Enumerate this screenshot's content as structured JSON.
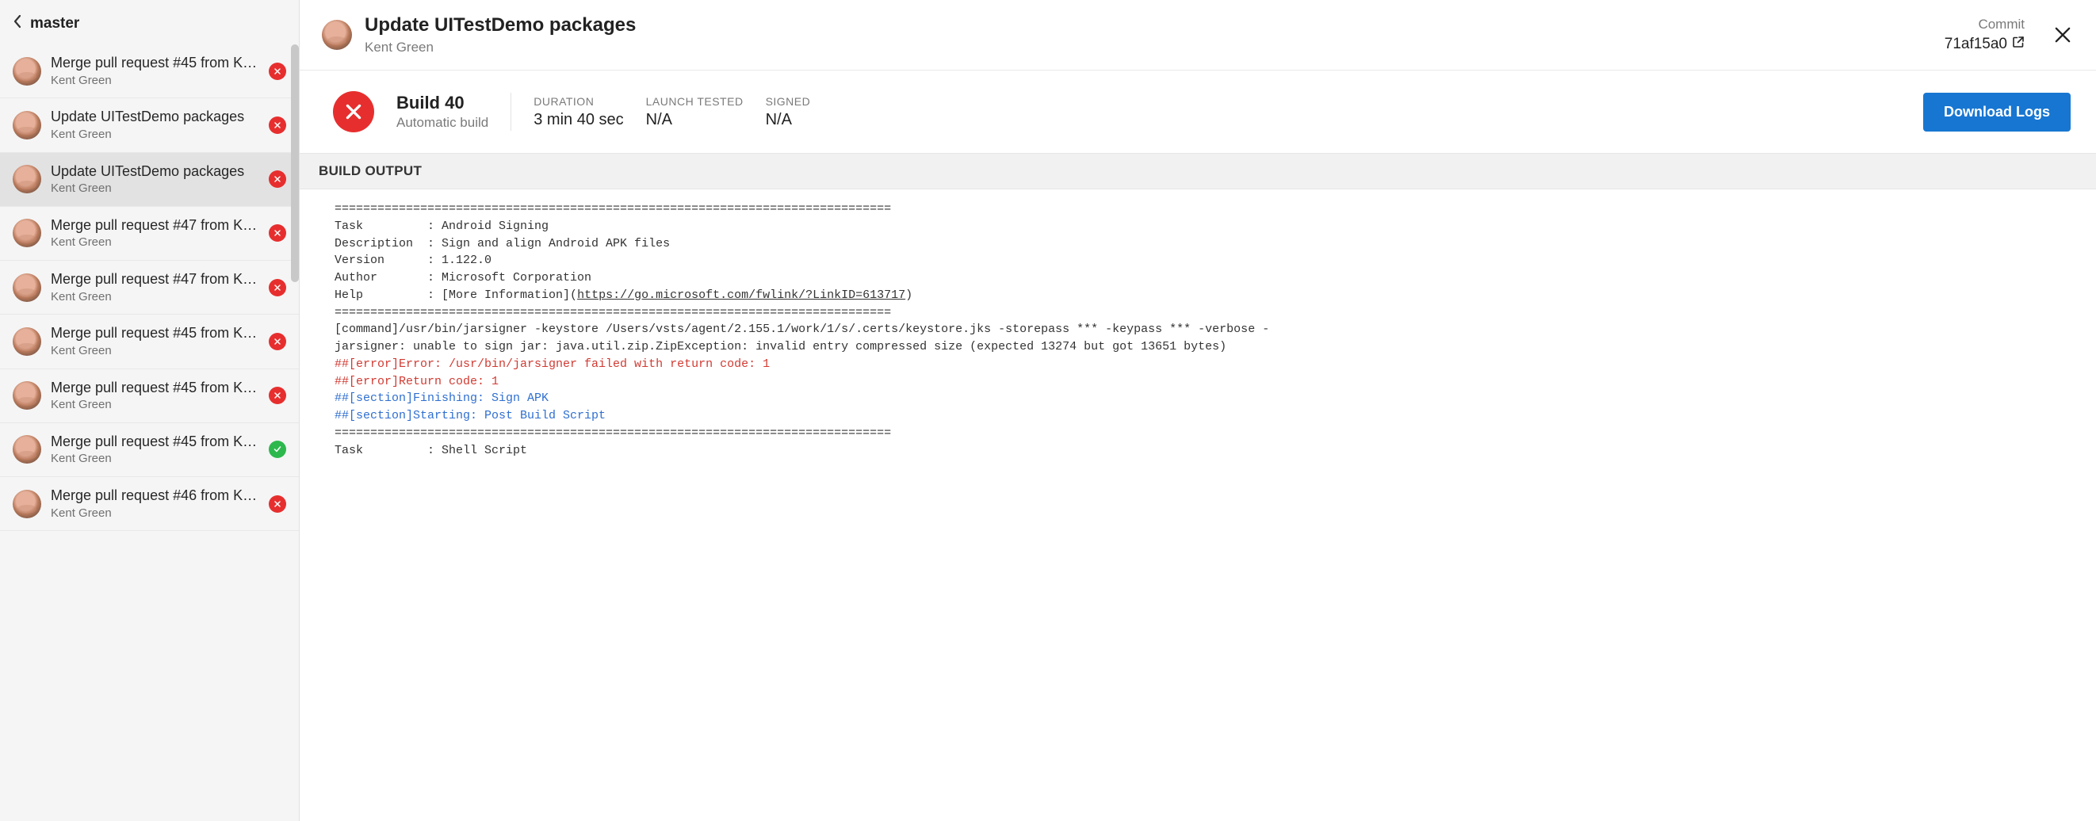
{
  "sidebar": {
    "branch": "master",
    "commits": [
      {
        "title": "Merge pull request #45 from Kin…",
        "author": "Kent Green",
        "status": "failed"
      },
      {
        "title": "Update UITestDemo packages",
        "author": "Kent Green",
        "status": "failed"
      },
      {
        "title": "Update UITestDemo packages",
        "author": "Kent Green",
        "status": "failed",
        "selected": true
      },
      {
        "title": "Merge pull request #47 from Kin…",
        "author": "Kent Green",
        "status": "failed"
      },
      {
        "title": "Merge pull request #47 from Kin…",
        "author": "Kent Green",
        "status": "failed"
      },
      {
        "title": "Merge pull request #45 from Kin…",
        "author": "Kent Green",
        "status": "failed"
      },
      {
        "title": "Merge pull request #45 from Kin…",
        "author": "Kent Green",
        "status": "failed"
      },
      {
        "title": "Merge pull request #45 from Kin…",
        "author": "Kent Green",
        "status": "success"
      },
      {
        "title": "Merge pull request #46 from Kin…",
        "author": "Kent Green",
        "status": "failed"
      }
    ]
  },
  "detail": {
    "title": "Update UITestDemo packages",
    "author": "Kent Green",
    "commit_label": "Commit",
    "commit_hash": "71af15a0",
    "build": {
      "id_label": "Build 40",
      "type": "Automatic build",
      "status": "failed",
      "metrics": {
        "duration_label": "DURATION",
        "duration_value": "3 min 40 sec",
        "launch_label": "LAUNCH TESTED",
        "launch_value": "N/A",
        "signed_label": "SIGNED",
        "signed_value": "N/A"
      },
      "download_label": "Download Logs"
    },
    "output_header": "BUILD OUTPUT",
    "output": {
      "hr": "==============================================================================",
      "l_task": "Task         : Android Signing",
      "l_desc": "Description  : Sign and align Android APK files",
      "l_ver": "Version      : 1.122.0",
      "l_auth": "Author       : Microsoft Corporation",
      "l_help_pre": "Help         : [More Information](",
      "l_help_url": "https://go.microsoft.com/fwlink/?LinkID=613717",
      "l_help_post": ")",
      "l_cmd": "[command]/usr/bin/jarsigner -keystore /Users/vsts/agent/2.155.1/work/1/s/.certs/keystore.jks -storepass *** -keypass *** -verbose -",
      "l_jar": "jarsigner: unable to sign jar: java.util.zip.ZipException: invalid entry compressed size (expected 13274 but got 13651 bytes)",
      "l_err1": "##[error]Error: /usr/bin/jarsigner failed with return code: 1",
      "l_err2": "##[error]Return code: 1",
      "l_sec1": "##[section]Finishing: Sign APK",
      "l_sec2": "##[section]Starting: Post Build Script",
      "l_task2": "Task         : Shell Script"
    }
  }
}
